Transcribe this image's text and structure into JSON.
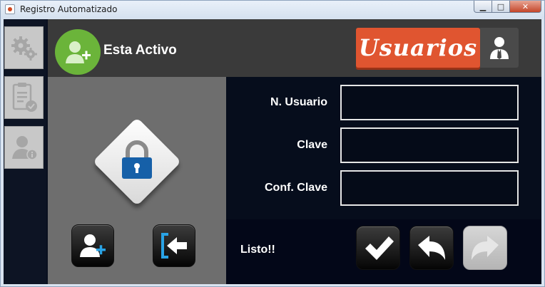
{
  "window": {
    "title": "Registro Automatizado",
    "controls": {
      "minimize": "▭",
      "maximize": "□",
      "close": "✕"
    }
  },
  "sidebar": {
    "items": [
      {
        "name": "settings",
        "icon": "gears-icon"
      },
      {
        "name": "reports",
        "icon": "clipboard-check-icon"
      },
      {
        "name": "user-info",
        "icon": "user-info-icon"
      }
    ]
  },
  "header": {
    "status": "Esta Activo",
    "section_title": "Usuarios",
    "avatar_icon": "add-user-icon",
    "section_icon": "business-user-icon"
  },
  "form": {
    "fields": [
      {
        "label": "N. Usuario",
        "value": ""
      },
      {
        "label": "Clave",
        "value": ""
      },
      {
        "label": "Conf. Clave",
        "value": ""
      }
    ]
  },
  "actions": {
    "status_message": "Listo!!",
    "left_buttons": [
      "add-user-icon",
      "logout-icon"
    ],
    "right_buttons": [
      "check-icon",
      "undo-icon",
      "redo-icon"
    ]
  },
  "colors": {
    "accent_orange": "#e05530",
    "status_green": "#6bb43a",
    "lock_blue": "#1660a8",
    "background_dark": "#0a1020"
  }
}
